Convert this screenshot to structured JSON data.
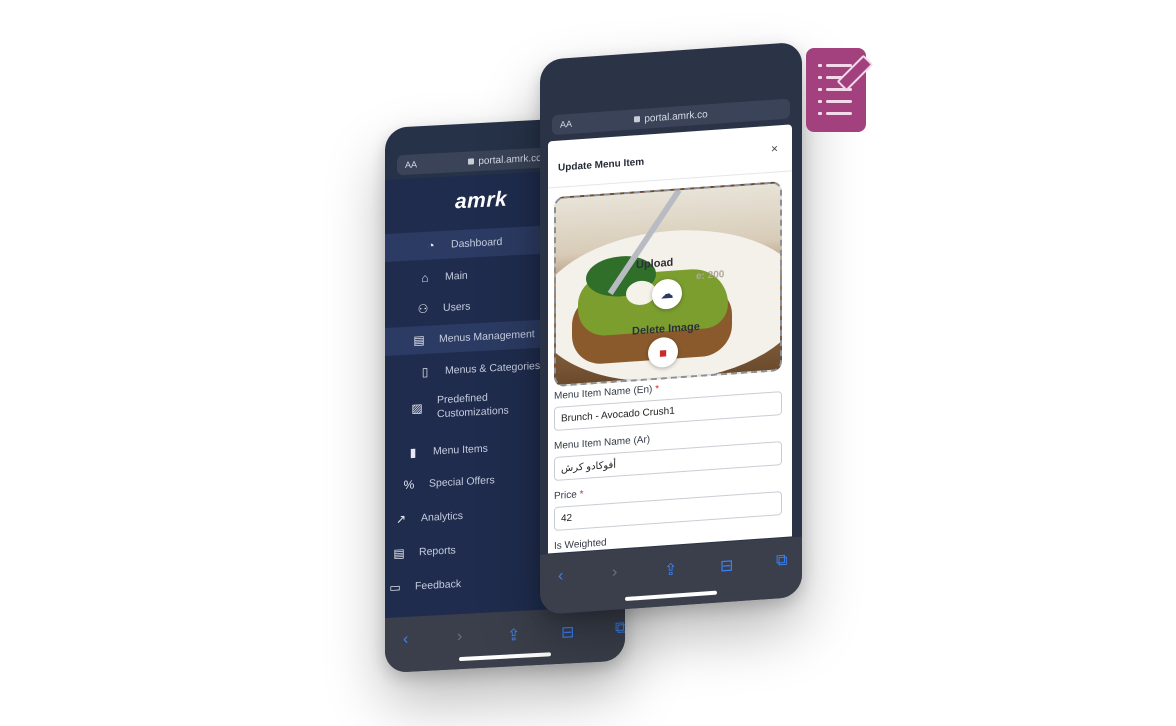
{
  "back_phone": {
    "url_aa": "AA",
    "url": "portal.amrk.co",
    "logo": "amrk",
    "nav": [
      {
        "label": "Dashboard",
        "icon": "gauge-icon"
      },
      {
        "label": "Main",
        "icon": "home-icon"
      },
      {
        "label": "Users",
        "icon": "users-icon"
      },
      {
        "label": "Menus Management",
        "icon": "menu-book-icon"
      },
      {
        "label": "Menus & Categories",
        "icon": "list-icon"
      },
      {
        "label": "Predefined Customizations",
        "icon": "customize-icon"
      },
      {
        "label": "Menu Items",
        "icon": "menu-item-icon"
      },
      {
        "label": "Special Offers",
        "icon": "offer-icon"
      },
      {
        "label": "Analytics",
        "icon": "chart-icon"
      },
      {
        "label": "Reports",
        "icon": "report-icon"
      },
      {
        "label": "Feedback",
        "icon": "feedback-icon"
      }
    ]
  },
  "front_phone": {
    "url_aa": "AA",
    "url": "portal.amrk.co",
    "modal": {
      "title": "Update Menu Item",
      "close": "×",
      "upload_text": "Upload",
      "upload_sub": "e: 200",
      "delete_text": "Delete Image",
      "fields": [
        {
          "label": "Menu Item Name (En)",
          "required": "*",
          "value": "Brunch - Avocado Crush1"
        },
        {
          "label": "Menu Item Name (Ar)",
          "required": "",
          "value": "أفوكادو كرش"
        },
        {
          "label": "Price",
          "required": "*",
          "value": "42"
        },
        {
          "label": "Is Weighted",
          "required": "",
          "value": ""
        }
      ]
    }
  },
  "colors": {
    "sidebar": "#1f2c4d",
    "accent": "#a3417f",
    "ios_blue": "#3d82f7"
  }
}
